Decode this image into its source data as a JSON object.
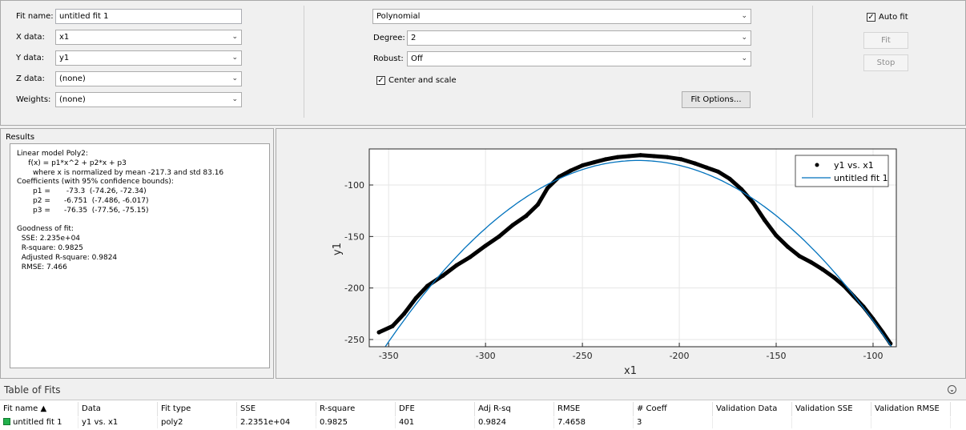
{
  "fit_name": {
    "label": "Fit name:",
    "value": "untitled fit 1"
  },
  "x_data": {
    "label": "X data:",
    "value": "x1"
  },
  "y_data": {
    "label": "Y data:",
    "value": "y1"
  },
  "z_data": {
    "label": "Z data:",
    "value": "(none)"
  },
  "weights": {
    "label": "Weights:",
    "value": "(none)"
  },
  "fit_type": {
    "value": "Polynomial"
  },
  "degree": {
    "label": "Degree:",
    "value": "2"
  },
  "robust": {
    "label": "Robust:",
    "value": "Off"
  },
  "center_scale": {
    "label": "Center and scale",
    "checked": true
  },
  "fit_options_button": "Fit Options...",
  "auto_fit": {
    "label": "Auto fit",
    "checked": true
  },
  "fit_button": "Fit",
  "stop_button": "Stop",
  "results": {
    "title": "Results",
    "text": "Linear model Poly2:\n     f(x) = p1*x^2 + p2*x + p3\n       where x is normalized by mean -217.3 and std 83.16\nCoefficients (with 95% confidence bounds):\n       p1 =       -73.3  (-74.26, -72.34)\n       p2 =      -6.751  (-7.486, -6.017)\n       p3 =      -76.35  (-77.56, -75.15)\n\nGoodness of fit:\n  SSE: 2.235e+04\n  R-square: 0.9825\n  Adjusted R-square: 0.9824\n  RMSE: 7.466"
  },
  "chart_data": {
    "type": "scatter",
    "xlabel": "x1",
    "ylabel": "y1",
    "xlim": [
      -360,
      -88
    ],
    "ylim": [
      -257,
      -65
    ],
    "xticks": [
      -350,
      -300,
      -250,
      -200,
      -150,
      -100
    ],
    "yticks": [
      -100,
      -150,
      -200,
      -250
    ],
    "grid": true,
    "legend": {
      "placement": "top-right",
      "entries": [
        "y1 vs. x1",
        "untitled fit 1"
      ]
    },
    "series": [
      {
        "name": "y1 vs. x1",
        "style": "points",
        "color": "#000000",
        "x": [
          -355,
          -348,
          -342,
          -336,
          -330,
          -322,
          -315,
          -308,
          -300,
          -293,
          -286,
          -279,
          -273,
          -268,
          -262,
          -256,
          -250,
          -244,
          -238,
          -232,
          -226,
          -220,
          -213,
          -206,
          -199,
          -192,
          -186,
          -180,
          -174,
          -168,
          -162,
          -156,
          -150,
          -144,
          -138,
          -132,
          -126,
          -120,
          -115,
          -110,
          -105,
          -100,
          -95,
          -91
        ],
        "y": [
          -243,
          -237,
          -225,
          -210,
          -198,
          -188,
          -178,
          -170,
          -159,
          -150,
          -139,
          -130,
          -119,
          -103,
          -92,
          -86,
          -81,
          -78,
          -75,
          -73,
          -72,
          -71,
          -72,
          -73,
          -75,
          -79,
          -83,
          -87,
          -94,
          -104,
          -117,
          -134,
          -149,
          -160,
          -169,
          -175,
          -182,
          -190,
          -198,
          -208,
          -218,
          -230,
          -243,
          -254
        ]
      },
      {
        "name": "untitled fit 1",
        "style": "line",
        "color": "#0072bd",
        "model": "poly2",
        "mean": -217.3,
        "std": 83.16,
        "p1": -73.3,
        "p2": -6.751,
        "p3": -76.35
      }
    ]
  },
  "table_of_fits": {
    "title": "Table of Fits",
    "columns": [
      "Fit name ▲",
      "Data",
      "Fit type",
      "SSE",
      "R-square",
      "DFE",
      "Adj R-sq",
      "RMSE",
      "# Coeff",
      "Validation Data",
      "Validation SSE",
      "Validation RMSE"
    ],
    "rows": [
      [
        "untitled fit 1",
        "y1 vs. x1",
        "poly2",
        "2.2351e+04",
        "0.9825",
        "401",
        "0.9824",
        "7.4658",
        "3",
        "",
        "",
        ""
      ]
    ],
    "row_status_color": "#22b14c"
  }
}
